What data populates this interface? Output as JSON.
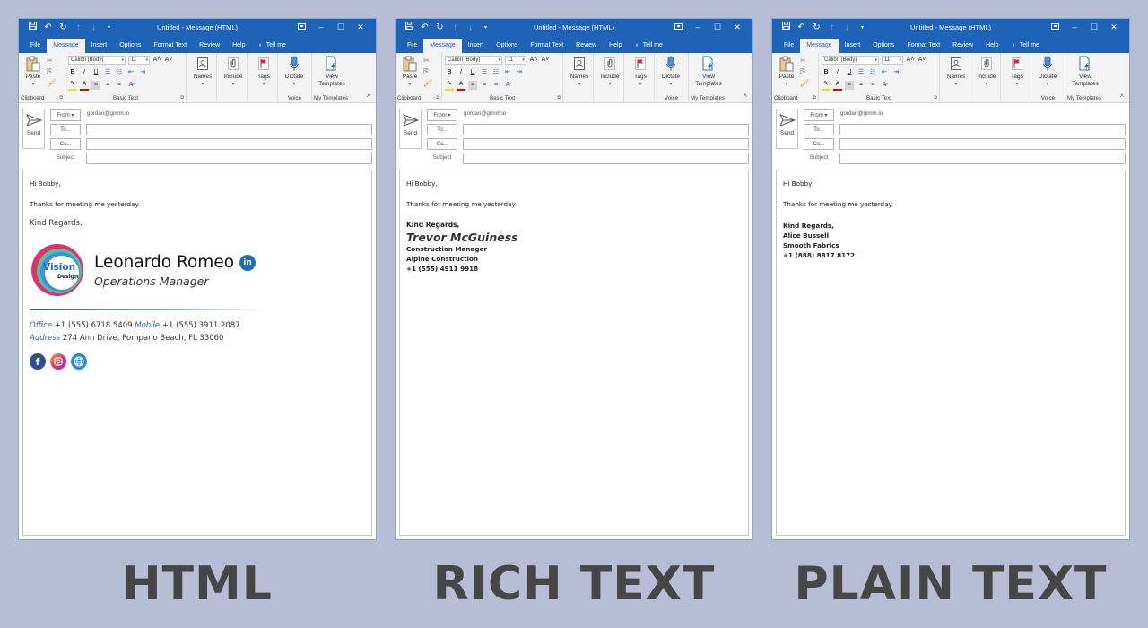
{
  "window": {
    "title": "Untitled  -  Message (HTML)",
    "quick_access": {
      "save": "save-icon",
      "undo": "undo-icon",
      "redo": "redo-icon",
      "up": "up-arrow-icon",
      "down": "down-arrow-icon",
      "customize": "customize-icon"
    },
    "controls": {
      "restore_ribbon": "ribbon-display-icon",
      "minimize": "–",
      "maximize": "☐",
      "close": "✕"
    }
  },
  "tabs": [
    {
      "label": "File",
      "active": false
    },
    {
      "label": "Message",
      "active": true
    },
    {
      "label": "Insert",
      "active": false
    },
    {
      "label": "Options",
      "active": false
    },
    {
      "label": "Format Text",
      "active": false
    },
    {
      "label": "Review",
      "active": false
    },
    {
      "label": "Help",
      "active": false
    }
  ],
  "tell_me": "Tell me",
  "ribbon": {
    "clipboard": {
      "paste": "Paste",
      "label": "Clipboard"
    },
    "basic_text": {
      "font": "Calibri (Body)",
      "size": "11",
      "label": "Basic Text",
      "bold": "B",
      "italic": "I",
      "underline": "U"
    },
    "names": "Names",
    "include": "Include",
    "tags": "Tags",
    "dictate": "Dictate",
    "voice_label": "Voice",
    "view_templates_1": "View",
    "view_templates_2": "Templates",
    "my_templates_label": "My Templates"
  },
  "compose": {
    "send": "Send",
    "from_button": "From ▾",
    "from_value": "gordan@gimm.io",
    "to_button": "To...",
    "cc_button": "Cc...",
    "subject_label": "Subject",
    "to_value": "",
    "cc_value": "",
    "subject_value": ""
  },
  "panels": [
    {
      "format": "HTML",
      "greeting": "Hi Bobby,",
      "message": "Thanks for meeting me yesterday.",
      "closing": "Kind Regards,",
      "signature": {
        "logo_text": "Vision",
        "logo_sub": "Design",
        "name": "Leonardo Romeo",
        "title": "Operations Manager",
        "office_label": "Office",
        "office": "+1 (555) 6718 5409",
        "mobile_label": "Mobile",
        "mobile": "+1 (555) 3911 2087",
        "address_label": "Address",
        "address": "274 Ann Drive, Pompano Beach, FL 33060",
        "socials": [
          "facebook",
          "instagram",
          "website"
        ]
      },
      "colors": {
        "accent": "#2a62c6",
        "linkedin": "#1b6fb5"
      }
    },
    {
      "format": "RICH TEXT",
      "greeting": "Hi Bobby,",
      "message": "Thanks for meeting me yesterday.",
      "closing": "Kind Regards,",
      "signature": {
        "name": "Trevor McGuiness",
        "title": "Construction Manager",
        "company": "Alpine Construction",
        "phone": "+1 (555) 4911 9918"
      }
    },
    {
      "format": "PLAIN TEXT",
      "greeting": "Hi Bobby,",
      "message": "Thanks for meeting me yesterday.",
      "closing": "Kind Regards,",
      "signature": {
        "name": "Alice Bussell",
        "company": "Smooth Fabrics",
        "phone": "+1 (888) 8817 8172"
      }
    }
  ],
  "colors": {
    "background": "#b6bdd4",
    "titlebar": "#1e63b8",
    "caption": "#464646"
  }
}
